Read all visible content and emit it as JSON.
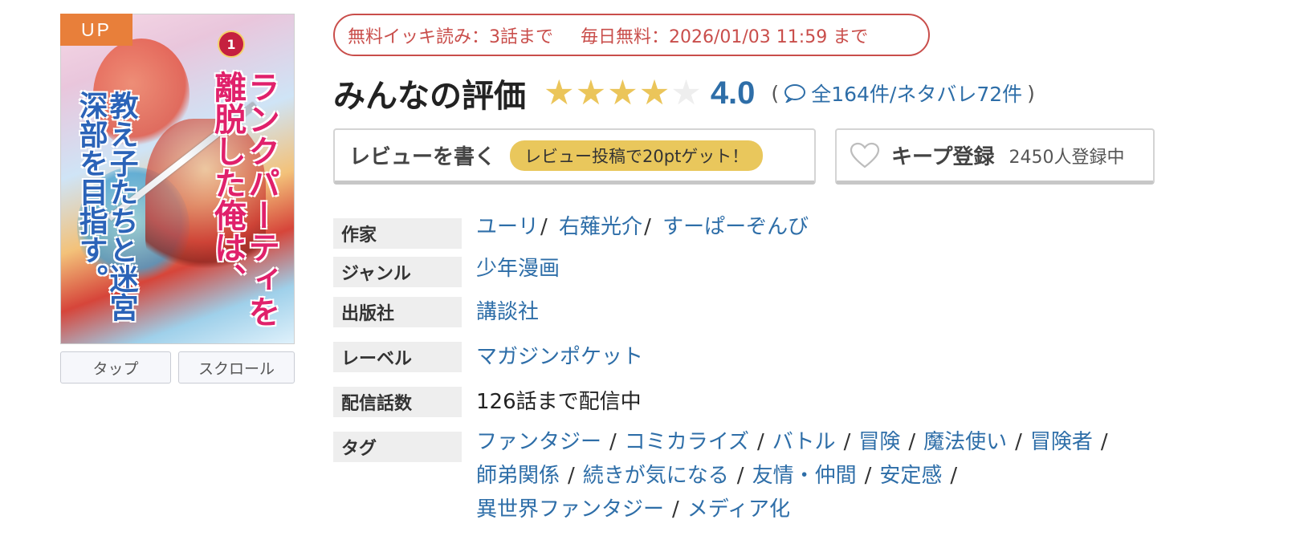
{
  "cover": {
    "badge": "UP",
    "volume": "1",
    "title_vertical_right": "ランクパーティを離脱した俺は、",
    "title_vertical_left": "教え子たちと迷宮深部を目指す。",
    "buttons": {
      "tap": "タップ",
      "scroll": "スクロール"
    }
  },
  "free_info": {
    "ikki": "無料イッキ読み：3話まで",
    "daily": "毎日無料：2026/01/03 11:59 まで"
  },
  "rating": {
    "title": "みんなの評価",
    "score": "4.0",
    "stars_filled": 4,
    "stars_total": 5,
    "open_paren": "(",
    "close_paren": ")",
    "count_text": "全164件/ネタバレ72件"
  },
  "review_button": {
    "label": "レビューを書く",
    "promo": "レビュー投稿で20ptゲット！"
  },
  "keep_button": {
    "label": "キープ登録",
    "count": "2450人登録中"
  },
  "details": {
    "author": {
      "label": "作家",
      "values": [
        "ユーリ",
        "右薙光介",
        "すーぱーぞんび"
      ]
    },
    "genre": {
      "label": "ジャンル",
      "value": "少年漫画"
    },
    "publisher": {
      "label": "出版社",
      "value": "講談社"
    },
    "label_row": {
      "label": "レーベル",
      "value": "マガジンポケット"
    },
    "episodes": {
      "label": "配信話数",
      "value": "126話まで配信中"
    },
    "tags": {
      "label": "タグ",
      "lines": [
        [
          "ファンタジー",
          "コミカライズ",
          "バトル",
          "冒険",
          "魔法使い",
          "冒険者"
        ],
        [
          "師弟関係",
          "続きが気になる",
          "友情・仲間",
          "安定感"
        ],
        [
          "異世界ファンタジー",
          "メディア化"
        ]
      ]
    }
  },
  "colors": {
    "accent_blue": "#2e6ea8",
    "free_red": "#c94e4b",
    "star_gold": "#ebc55a",
    "star_empty": "#eeeeee",
    "badge_orange": "#e87f3a",
    "pill_yellow": "#e9c75c"
  },
  "icons": {
    "bubble": "speech-bubble-icon",
    "heart": "heart-icon",
    "star": "star-icon"
  }
}
